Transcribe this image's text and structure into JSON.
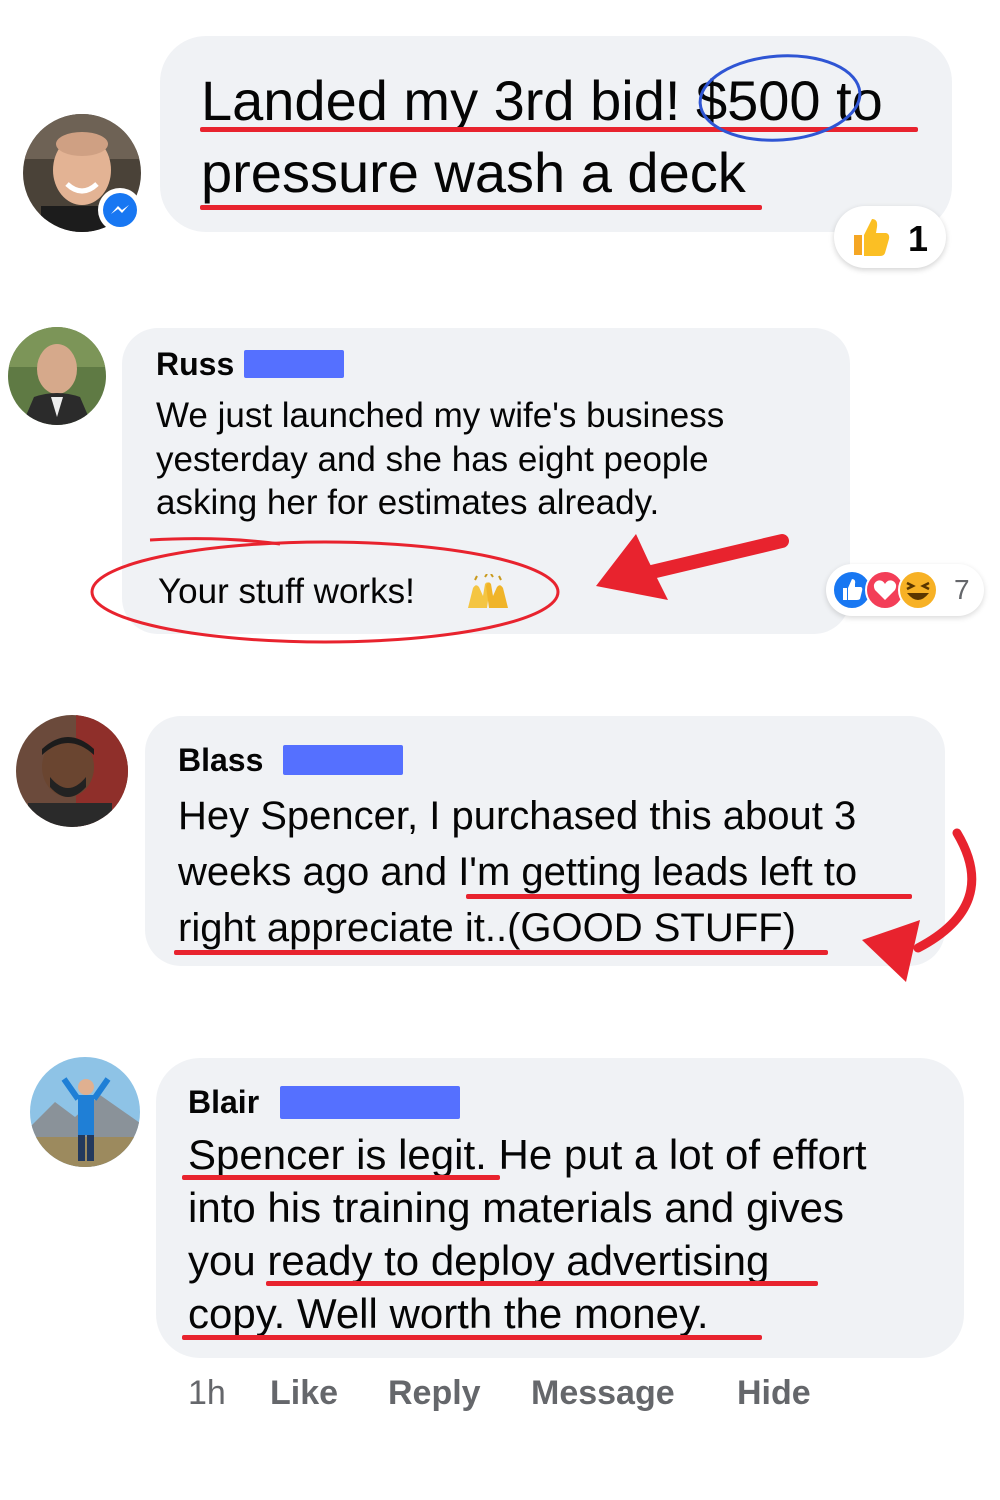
{
  "messages": [
    {
      "lines": [
        "Landed my 3rd bid! $500 to",
        "pressure wash a deck"
      ],
      "reaction": {
        "icon": "thumbs-up-icon",
        "count": "1"
      },
      "avatar_badge": "messenger-icon"
    },
    {
      "author": "Russ",
      "lines": [
        "We just launched my wife's business",
        "yesterday and she has eight people",
        "asking her for estimates already."
      ],
      "highlight": "Your stuff works!",
      "highlight_emoji": "raising-hands-icon",
      "reactions": {
        "icons": [
          "like-icon",
          "love-icon",
          "haha-icon"
        ],
        "count": "7"
      }
    },
    {
      "author": "Blass",
      "lines": [
        "Hey Spencer, I purchased this about 3",
        "weeks ago and I'm getting leads left to",
        "right appreciate it..(GOOD STUFF)"
      ]
    },
    {
      "author": "Blair",
      "lines": [
        "Spencer is legit. He put a lot of effort",
        "into his training materials and gives",
        "you ready to deploy advertising",
        "copy. Well worth the money."
      ]
    }
  ],
  "footer": {
    "time": "1h",
    "like": "Like",
    "reply": "Reply",
    "message": "Message",
    "hide": "Hide"
  },
  "colors": {
    "bubble": "#f0f2f5",
    "annotation_red": "#e8232e",
    "annotation_blue": "#2f55d4",
    "redaction": "#5570ff",
    "meta_text": "#65676b"
  }
}
